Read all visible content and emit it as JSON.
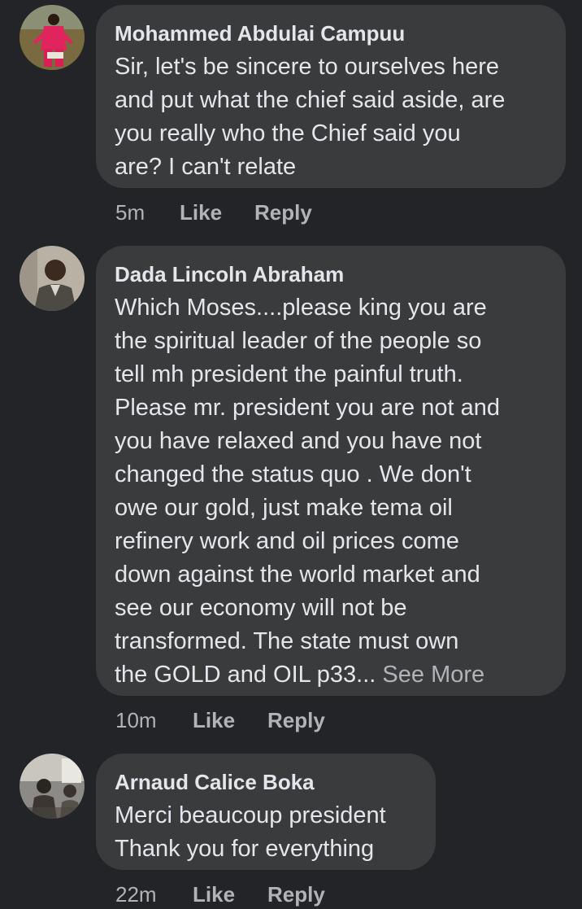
{
  "comments": [
    {
      "author": "Mohammed Abdulai Campuu",
      "lines": [
        "Sir, let's be sincere to ourselves here",
        "and put what the chief said aside, are",
        "you really who the Chief said you",
        "are? I can't relate"
      ],
      "time": "5m",
      "like_label": "Like",
      "reply_label": "Reply"
    },
    {
      "author": "Dada Lincoln Abraham",
      "lines": [
        "Which Moses....please  king you are",
        "the spiritual leader  of the people so",
        "tell mh president the painful truth.",
        "Please  mr. president you are not and",
        "you have relaxed and you have not",
        "changed the status quo . We don't",
        "owe our gold, just make tema oil",
        "refinery work and oil prices come",
        "down against the world market and",
        "see our economy will not be",
        "transformed.  The state must own",
        "the GOLD and OIL p33..."
      ],
      "see_more": "See More",
      "time": "10m",
      "like_label": "Like",
      "reply_label": "Reply"
    },
    {
      "author": "Arnaud Calice Boka",
      "lines": [
        "Merci beaucoup president",
        "Thank you for everything"
      ],
      "time": "22m",
      "like_label": "Like",
      "reply_label": "Reply"
    }
  ],
  "colors": {
    "background": "#232427",
    "bubble": "#3a3b3c",
    "text": "#e4e6eb",
    "secondary": "#b0b3b8"
  }
}
